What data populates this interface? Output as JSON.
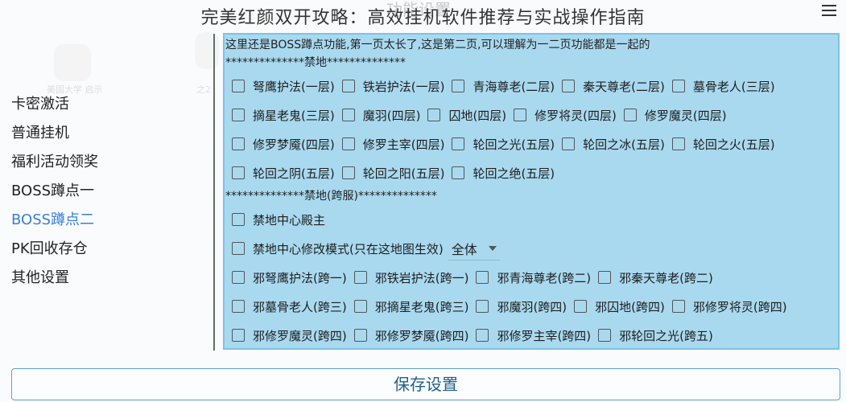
{
  "header": {
    "ghost_title": "功能设置",
    "overlay_title": "完美红颜双开攻略：高效挂机软件推荐与实战操作指南",
    "menu_icon": "hamburger-menu-icon"
  },
  "background": {
    "app_label": "美国大学 启示",
    "app_label_2": "之2"
  },
  "sidebar": {
    "items": [
      {
        "label": "卡密激活"
      },
      {
        "label": "普通挂机"
      },
      {
        "label": "福利活动领奖"
      },
      {
        "label": "BOSS蹲点一"
      },
      {
        "label": "BOSS蹲点二",
        "active": true
      },
      {
        "label": "PK回收存仓"
      },
      {
        "label": "其他设置"
      }
    ]
  },
  "panel": {
    "note": "这里还是BOSS蹲点功能,第一页太长了,这是第二页,可以理解为一二页功能都是一起的",
    "section1_header": "**************禁地**************",
    "section1": {
      "row1": [
        "弩鹰护法(一层)",
        "铁岩护法(一层)",
        "青海尊老(二层)",
        "秦天尊老(二层)",
        "墓骨老人(三层)"
      ],
      "row2": [
        "摘星老鬼(三层)",
        "魔羽(四层)",
        "囚地(四层)",
        "修罗将灵(四层)",
        "修罗魔灵(四层)"
      ],
      "row3": [
        "修罗梦魇(四层)",
        "修罗主宰(四层)",
        "轮回之光(五层)",
        "轮回之冰(五层)",
        "轮回之火(五层)"
      ],
      "row4": [
        "轮回之阴(五层)",
        "轮回之阳(五层)",
        "轮回之绝(五层)"
      ]
    },
    "section2_header": "**************禁地(跨服)**************",
    "section2": {
      "lord": "禁地中心殿主",
      "modify_mode": "禁地中心修改模式(只在这地图生效)",
      "mode_select": "全体",
      "row3": [
        "邪弩鹰护法(跨一)",
        "邪铁岩护法(跨一)",
        "邪青海尊老(跨二)",
        "邪秦天尊老(跨二)"
      ],
      "row4": [
        "邪墓骨老人(跨三)",
        "邪摘星老鬼(跨三)",
        "邪魔羽(跨四)",
        "邪囚地(跨四)",
        "邪修罗将灵(跨四)"
      ],
      "row5": [
        "邪修罗魔灵(跨四)",
        "邪修罗梦魇(跨四)",
        "邪修罗主宰(跨四)",
        "邪轮回之光(跨五)"
      ]
    }
  },
  "footer": {
    "save_label": "保存设置"
  },
  "colors": {
    "panel_bg": "#a9d9ef",
    "panel_border": "#7cc3e6",
    "active_item": "#3a7fd6",
    "save_text": "#1f5f8a"
  }
}
